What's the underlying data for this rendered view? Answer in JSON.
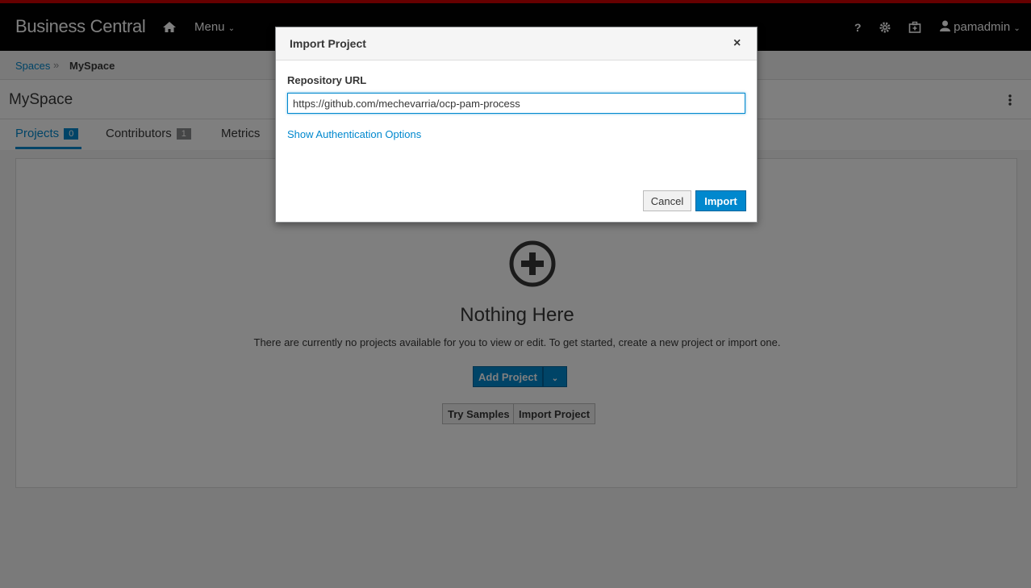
{
  "topbar": {
    "brand": "Business Central",
    "home_icon": "home-icon",
    "menu_label": "Menu",
    "help_icon_glyph": "?",
    "settings_icon": "gear-icon",
    "briefcase_icon": "briefcase-icon",
    "user_name": "pamadmin"
  },
  "breadcrumb": {
    "items": [
      "Spaces",
      "MySpace"
    ],
    "separator": "»"
  },
  "space": {
    "title": "MySpace"
  },
  "tabs": [
    {
      "label": "Projects",
      "count": "0",
      "active": true
    },
    {
      "label": "Contributors",
      "count": "1",
      "active": false
    },
    {
      "label": "Metrics",
      "active": false
    }
  ],
  "empty_state": {
    "title": "Nothing Here",
    "description": "There are currently no projects available for you to view or edit. To get started, create a new project or import one.",
    "add_button": "Add Project",
    "try_samples": "Try Samples",
    "import_project": "Import Project"
  },
  "modal": {
    "title": "Import Project",
    "close_glyph": "×",
    "field_label": "Repository URL",
    "url_value": "https://github.com/mechevarria/ocp-pam-process",
    "auth_link": "Show Authentication Options",
    "cancel": "Cancel",
    "import": "Import"
  },
  "colors": {
    "accent": "#0088ce",
    "topbar": "#030303",
    "redline": "#cc0000"
  }
}
